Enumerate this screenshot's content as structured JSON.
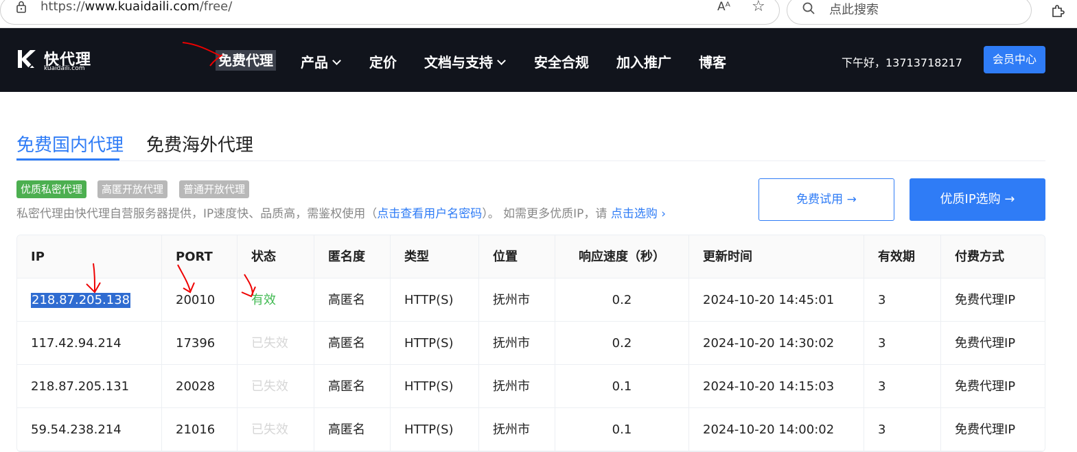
{
  "browser": {
    "url_prefix": "https://",
    "url_domain": "www.kuaidaili.com",
    "url_path": "/free/",
    "read_aloud": "Aᴬ",
    "search_placeholder": "点此搜索"
  },
  "nav": {
    "logo_cn": "快代理",
    "logo_en": "kuaidaili.com",
    "items": [
      {
        "label": "免费代理",
        "has_dropdown": false
      },
      {
        "label": "产品",
        "has_dropdown": true
      },
      {
        "label": "定价",
        "has_dropdown": false
      },
      {
        "label": "文档与支持",
        "has_dropdown": true
      },
      {
        "label": "安全合规",
        "has_dropdown": false
      },
      {
        "label": "加入推广",
        "has_dropdown": false
      },
      {
        "label": "博客",
        "has_dropdown": false
      }
    ],
    "greeting": "下午好，13713718217",
    "member_button": "会员中心"
  },
  "tabs": {
    "active": "免费国内代理",
    "other": "免费海外代理"
  },
  "badges": [
    "优质私密代理",
    "高匿开放代理",
    "普通开放代理"
  ],
  "description": {
    "text1": "私密代理由快代理自营服务器提供，IP速度快、品质高，需鉴权使用（",
    "link1": "点击查看用户名密码",
    "text2": "）。 如需更多优质IP，请 ",
    "link2": "点击选购 ›"
  },
  "buttons": {
    "trial": "免费试用 →",
    "buy": "优质IP选购 →"
  },
  "colors": {
    "accent": "#2f7cf6",
    "nav_bg": "#11141c",
    "valid": "#3fb950",
    "expired": "#d6d6d6"
  },
  "table": {
    "headers": [
      "IP",
      "PORT",
      "状态",
      "匿名度",
      "类型",
      "位置",
      "响应速度（秒）",
      "更新时间",
      "有效期",
      "付费方式"
    ],
    "rows": [
      [
        "218.87.205.138",
        "20010",
        "有效",
        "高匿名",
        "HTTP(S)",
        "抚州市",
        "0.2",
        "2024-10-20 14:45:01",
        "3",
        "免费代理IP"
      ],
      [
        "117.42.94.214",
        "17396",
        "已失效",
        "高匿名",
        "HTTP(S)",
        "抚州市",
        "0.2",
        "2024-10-20 14:30:02",
        "3",
        "免费代理IP"
      ],
      [
        "218.87.205.131",
        "20028",
        "已失效",
        "高匿名",
        "HTTP(S)",
        "抚州市",
        "0.1",
        "2024-10-20 14:15:03",
        "3",
        "免费代理IP"
      ],
      [
        "59.54.238.214",
        "21016",
        "已失效",
        "高匿名",
        "HTTP(S)",
        "抚州市",
        "0.1",
        "2024-10-20 14:00:02",
        "3",
        "免费代理IP"
      ]
    ]
  }
}
